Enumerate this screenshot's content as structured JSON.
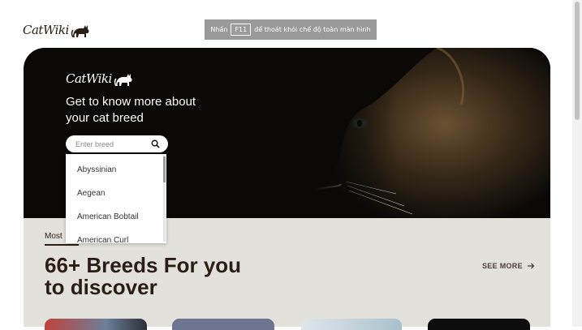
{
  "brand": {
    "name": "CatWiki"
  },
  "fullscreen_banner": {
    "prefix": "Nhấn",
    "key": "F11",
    "suffix": "để thoát khỏi chế độ toàn màn hình"
  },
  "hero": {
    "title": "Get to know more about your cat breed",
    "search": {
      "placeholder": "Enter breed",
      "value": ""
    },
    "dropdown": [
      "Abyssinian",
      "Aegean",
      "American Bobtail",
      "American Curl"
    ]
  },
  "section": {
    "label": "Most",
    "headline": "66+ Breeds For you to discover",
    "see_more": "SEE MORE",
    "cards": [
      "card-1",
      "card-2",
      "card-3",
      "card-4"
    ]
  },
  "colors": {
    "brand_dark": "#2a1d14",
    "hero_bg": "#0a0908",
    "section_bg": "#e3e1dc"
  },
  "icons": [
    "cat-logo-icon",
    "search-icon",
    "arrow-right-icon"
  ]
}
